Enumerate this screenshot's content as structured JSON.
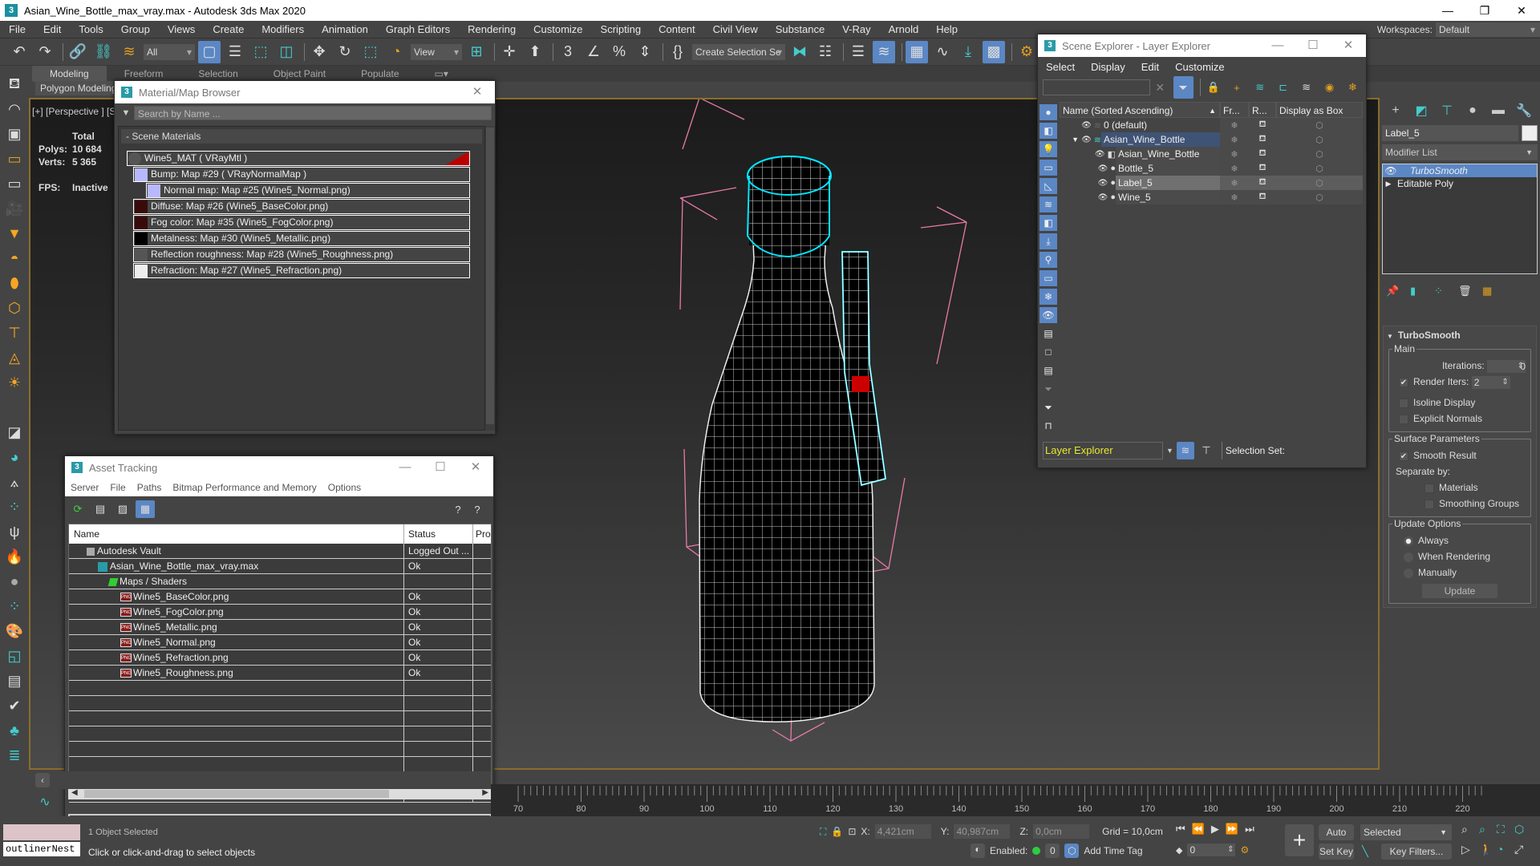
{
  "window": {
    "title": "Asian_Wine_Bottle_max_vray.max - Autodesk 3ds Max 2020",
    "app_icon": "3"
  },
  "menu": [
    "File",
    "Edit",
    "Tools",
    "Group",
    "Views",
    "Create",
    "Modifiers",
    "Animation",
    "Graph Editors",
    "Rendering",
    "Customize",
    "Scripting",
    "Content",
    "Civil View",
    "Substance",
    "V-Ray",
    "Arnold",
    "Help"
  ],
  "workspaces": {
    "label": "Workspaces:",
    "value": "Default"
  },
  "toolbar": {
    "selection_filter": "All",
    "ref_coord": "View",
    "named_selection": "Create Selection Se"
  },
  "ribbon": {
    "tabs": [
      "Modeling",
      "Freeform",
      "Selection",
      "Object Paint",
      "Populate"
    ],
    "active": "Modeling",
    "sub": "Polygon Modeling"
  },
  "viewport": {
    "label": "[+] [Perspective ] [S",
    "stats": {
      "header": "Total",
      "polys_label": "Polys:",
      "polys": "10 684",
      "verts_label": "Verts:",
      "verts": "5 365",
      "fps_label": "FPS:",
      "fps": "Inactive"
    }
  },
  "material_browser": {
    "title": "Material/Map Browser",
    "search_placeholder": "Search by Name ...",
    "group": "- Scene Materials",
    "items": [
      {
        "label": "Wine5_MAT  ( VRayMtl )",
        "level": 0,
        "swatch": "#333333"
      },
      {
        "label": "Bump: Map #29  ( VRayNormalMap )",
        "level": 1,
        "swatch": "#b8b8ff"
      },
      {
        "label": "Normal map: Map #25 (Wine5_Normal.png)",
        "level": 2,
        "swatch": "#b8b8ff"
      },
      {
        "label": "Diffuse: Map #26 (Wine5_BaseColor.png)",
        "level": 1,
        "swatch": "#3a0a0a"
      },
      {
        "label": "Fog color: Map #35 (Wine5_FogColor.png)",
        "level": 1,
        "swatch": "#3a0a0a"
      },
      {
        "label": "Metalness: Map #30 (Wine5_Metallic.png)",
        "level": 1,
        "swatch": "#000000"
      },
      {
        "label": "Reflection roughness: Map #28 (Wine5_Roughness.png)",
        "level": 1,
        "swatch": "#555555"
      },
      {
        "label": "Refraction: Map #27 (Wine5_Refraction.png)",
        "level": 1,
        "swatch": "#eeeeee"
      }
    ]
  },
  "asset_tracking": {
    "title": "Asset Tracking",
    "menu": [
      "Server",
      "File",
      "Paths",
      "Bitmap Performance and Memory",
      "Options"
    ],
    "columns": [
      "Name",
      "Status",
      "Pro"
    ],
    "rows": [
      {
        "name": "Autodesk Vault",
        "status": "Logged Out ...",
        "indent": 1,
        "icon": "vault"
      },
      {
        "name": "Asian_Wine_Bottle_max_vray.max",
        "status": "Ok",
        "indent": 2,
        "icon": "max"
      },
      {
        "name": "Maps / Shaders",
        "status": "",
        "indent": 3,
        "icon": "maps"
      },
      {
        "name": "Wine5_BaseColor.png",
        "status": "Ok",
        "indent": 4,
        "icon": "png"
      },
      {
        "name": "Wine5_FogColor.png",
        "status": "Ok",
        "indent": 4,
        "icon": "png"
      },
      {
        "name": "Wine5_Metallic.png",
        "status": "Ok",
        "indent": 4,
        "icon": "png"
      },
      {
        "name": "Wine5_Normal.png",
        "status": "Ok",
        "indent": 4,
        "icon": "png"
      },
      {
        "name": "Wine5_Refraction.png",
        "status": "Ok",
        "indent": 4,
        "icon": "png"
      },
      {
        "name": "Wine5_Roughness.png",
        "status": "Ok",
        "indent": 4,
        "icon": "png"
      }
    ],
    "png_badge": "PNG"
  },
  "scene_explorer": {
    "title": "Scene Explorer - Layer Explorer",
    "menu": [
      "Select",
      "Display",
      "Edit",
      "Customize"
    ],
    "columns": [
      "Name (Sorted Ascending)",
      "Fr...",
      "R...",
      "Display as Box"
    ],
    "rows": [
      {
        "name": "0 (default)",
        "level": 0,
        "type": "layer",
        "selected": false
      },
      {
        "name": "Asian_Wine_Bottle",
        "level": 0,
        "type": "layer-active",
        "selected": true,
        "expanded": true
      },
      {
        "name": "Asian_Wine_Bottle",
        "level": 1,
        "type": "group",
        "selected": false
      },
      {
        "name": "Bottle_5",
        "level": 1,
        "type": "object",
        "selected": false
      },
      {
        "name": "Label_5",
        "level": 1,
        "type": "object",
        "selected": true
      },
      {
        "name": "Wine_5",
        "level": 1,
        "type": "object",
        "selected": false
      }
    ],
    "bottom_mode": "Layer Explorer",
    "selection_set_label": "Selection Set:"
  },
  "command_panel": {
    "object_name": "Label_5",
    "modifier_list": "Modifier List",
    "stack": [
      {
        "name": "TurboSmooth",
        "active": true
      },
      {
        "name": "Editable Poly",
        "active": false
      }
    ],
    "rollout_title": "TurboSmooth",
    "main_label": "Main",
    "iterations_label": "Iterations:",
    "iterations": "0",
    "render_iters_label": "Render Iters:",
    "render_iters": "2",
    "render_iters_checked": true,
    "isoline_label": "Isoline Display",
    "isoline_checked": false,
    "explicit_normals_label": "Explicit Normals",
    "explicit_normals_checked": false,
    "surface_label": "Surface Parameters",
    "smooth_result_label": "Smooth Result",
    "smooth_result_checked": true,
    "separate_by_label": "Separate by:",
    "materials_label": "Materials",
    "smoothing_groups_label": "Smoothing Groups",
    "update_label": "Update Options",
    "update_options": [
      "Always",
      "When Rendering",
      "Manually"
    ],
    "update_selected": "Always",
    "update_button": "Update"
  },
  "timeline": {
    "ticks": [
      "70",
      "80",
      "90",
      "100",
      "110",
      "120",
      "130",
      "140",
      "150",
      "160",
      "170",
      "180",
      "190",
      "200",
      "210",
      "220"
    ]
  },
  "status": {
    "maxscript_listener": "outlinerNest",
    "selected_count": "1 Object Selected",
    "prompt": "Click or click-and-drag to select objects",
    "x_label": "X:",
    "x": "4,421cm",
    "y_label": "Y:",
    "y": "40,987cm",
    "z_label": "Z:",
    "z": "0,0cm",
    "grid": "Grid = 10,0cm",
    "enabled_label": "Enabled:",
    "add_time_tag": "Add Time Tag",
    "frame": "0",
    "auto_key": "Auto Key",
    "set_key": "Set Key",
    "key_mode": "Selected",
    "key_filters": "Key Filters..."
  },
  "colors": {
    "accent_blue": "#5b87c5",
    "selection_cyan": "#00e5ff",
    "viewport_border": "#8a6d2a",
    "layer_yellow": "#e7e730"
  }
}
